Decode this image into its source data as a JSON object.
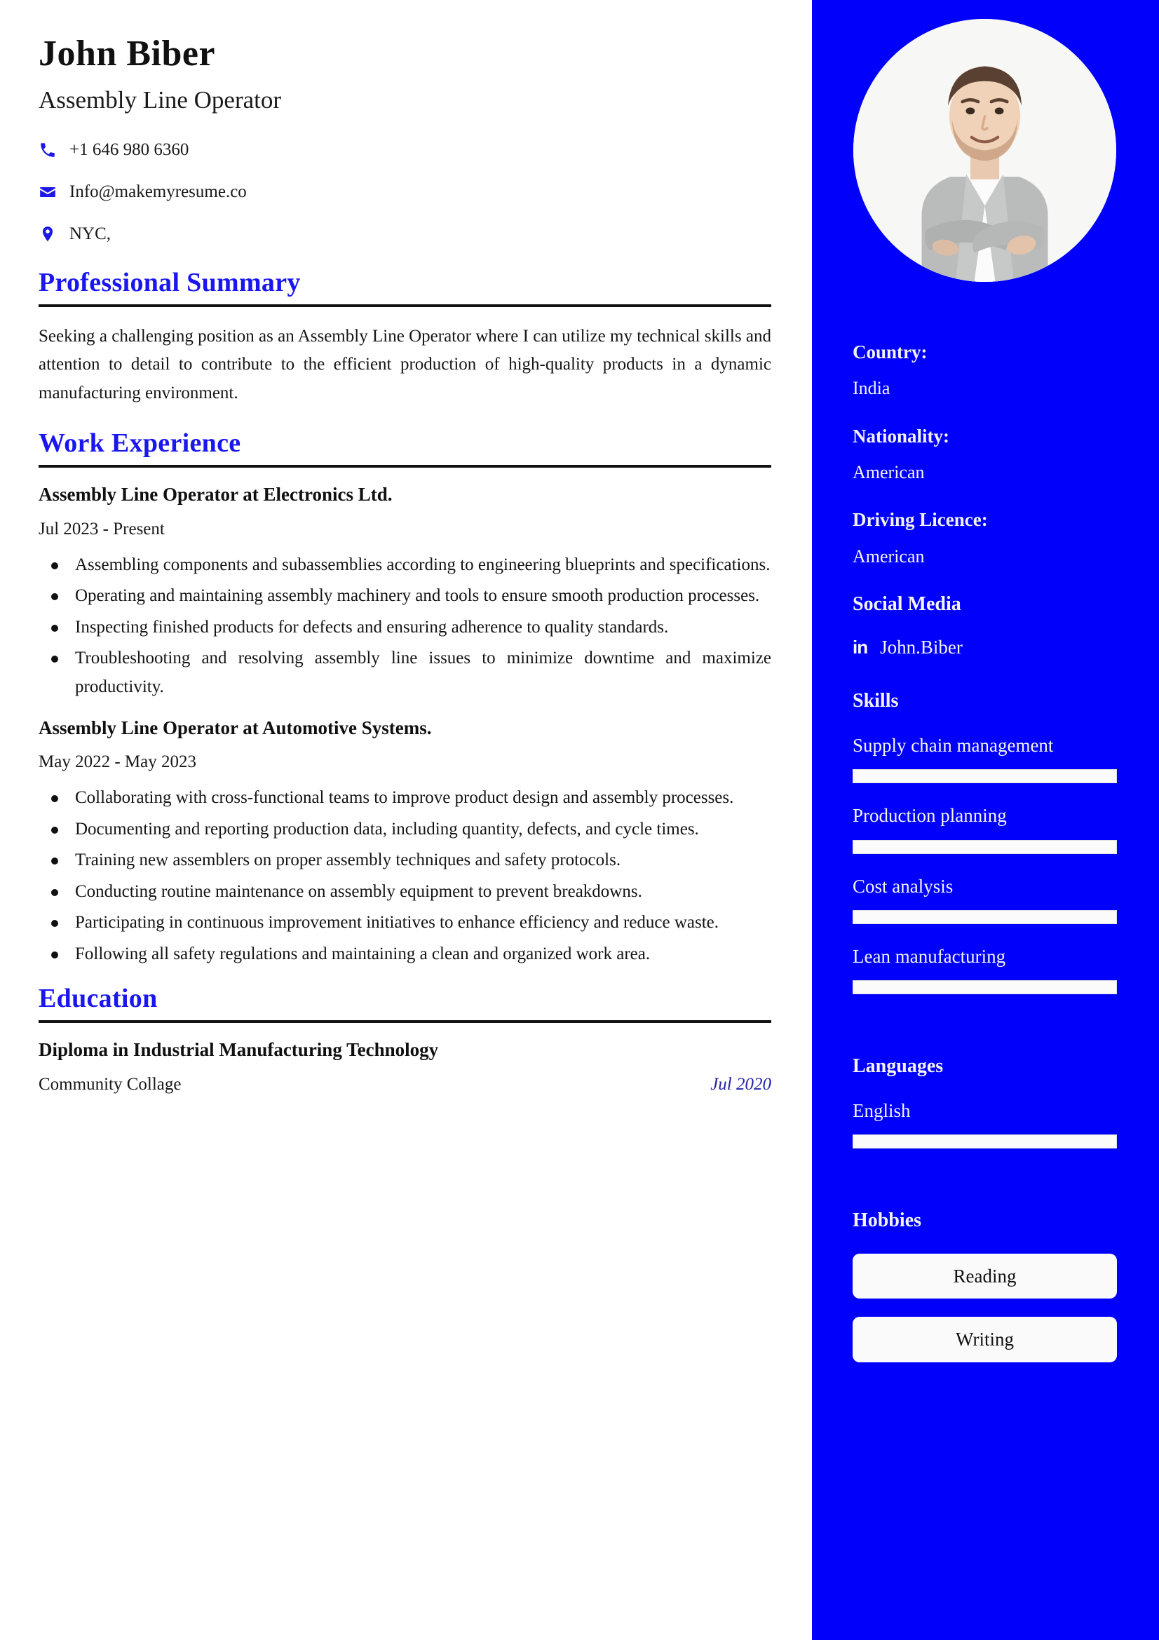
{
  "header": {
    "name": "John Biber",
    "job_title": "Assembly Line Operator",
    "contacts": [
      {
        "icon": "phone-icon",
        "value": "+1 646 980 6360"
      },
      {
        "icon": "email-icon",
        "value": "Info@makemyresume.co"
      },
      {
        "icon": "location-icon",
        "value": "NYC,"
      }
    ]
  },
  "sections": {
    "summary_title": "Professional Summary",
    "summary_text": "Seeking a challenging position as an Assembly Line Operator where I can utilize my technical skills and attention to detail to contribute to the efficient production of high-quality products in a dynamic manufacturing environment.",
    "work_title": "Work Experience",
    "education_title": "Education"
  },
  "jobs": [
    {
      "heading": "Assembly Line Operator at Electronics Ltd.",
      "dates": "Jul 2023 - Present",
      "bullets": [
        "Assembling components and subassemblies according to engineering blueprints and specifications.",
        "Operating and maintaining assembly machinery and tools to ensure smooth production processes.",
        "Inspecting finished products for defects and ensuring adherence to quality standards.",
        "Troubleshooting and resolving assembly line issues to minimize downtime and maximize productivity."
      ]
    },
    {
      "heading": "Assembly Line Operator at Automotive Systems.",
      "dates": "May 2022 - May 2023",
      "bullets": [
        "Collaborating with cross-functional teams to improve product design and assembly processes.",
        "Documenting and reporting production data, including quantity, defects, and cycle times.",
        "Training new assemblers on proper assembly techniques and safety protocols.",
        "Conducting routine maintenance on assembly equipment to prevent breakdowns.",
        "Participating in continuous improvement initiatives to enhance efficiency and reduce waste.",
        "Following all safety regulations and maintaining a clean and organized work area."
      ]
    }
  ],
  "education": {
    "degree": "Diploma in Industrial Manufacturing Technology",
    "school": "Community Collage",
    "date": "Jul 2020"
  },
  "sidebar": {
    "avatar_alt": "profile-photo",
    "details": [
      {
        "label": "Country:",
        "value": "India"
      },
      {
        "label": "Nationality:",
        "value": "American"
      },
      {
        "label": "Driving Licence:",
        "value": "American"
      }
    ],
    "social_heading": "Social Media",
    "social": {
      "icon": "linkedin-icon",
      "icon_glyph": "in",
      "name": "John.Biber"
    },
    "skills_heading": "Skills",
    "skills": [
      {
        "name": "Supply chain management",
        "level": 100
      },
      {
        "name": "Production planning",
        "level": 100
      },
      {
        "name": "Cost analysis",
        "level": 100
      },
      {
        "name": "Lean manufacturing",
        "level": 100
      }
    ],
    "languages_heading": "Languages",
    "languages": [
      {
        "name": "English",
        "level": 100
      }
    ],
    "hobbies_heading": "Hobbies",
    "hobbies": [
      "Reading",
      "Writing"
    ]
  },
  "colors": {
    "sidebar_bg": "#0000fb",
    "accent_heading": "#1a16ef",
    "icon_blue": "#1c18e8",
    "edu_date": "#2222aa"
  }
}
